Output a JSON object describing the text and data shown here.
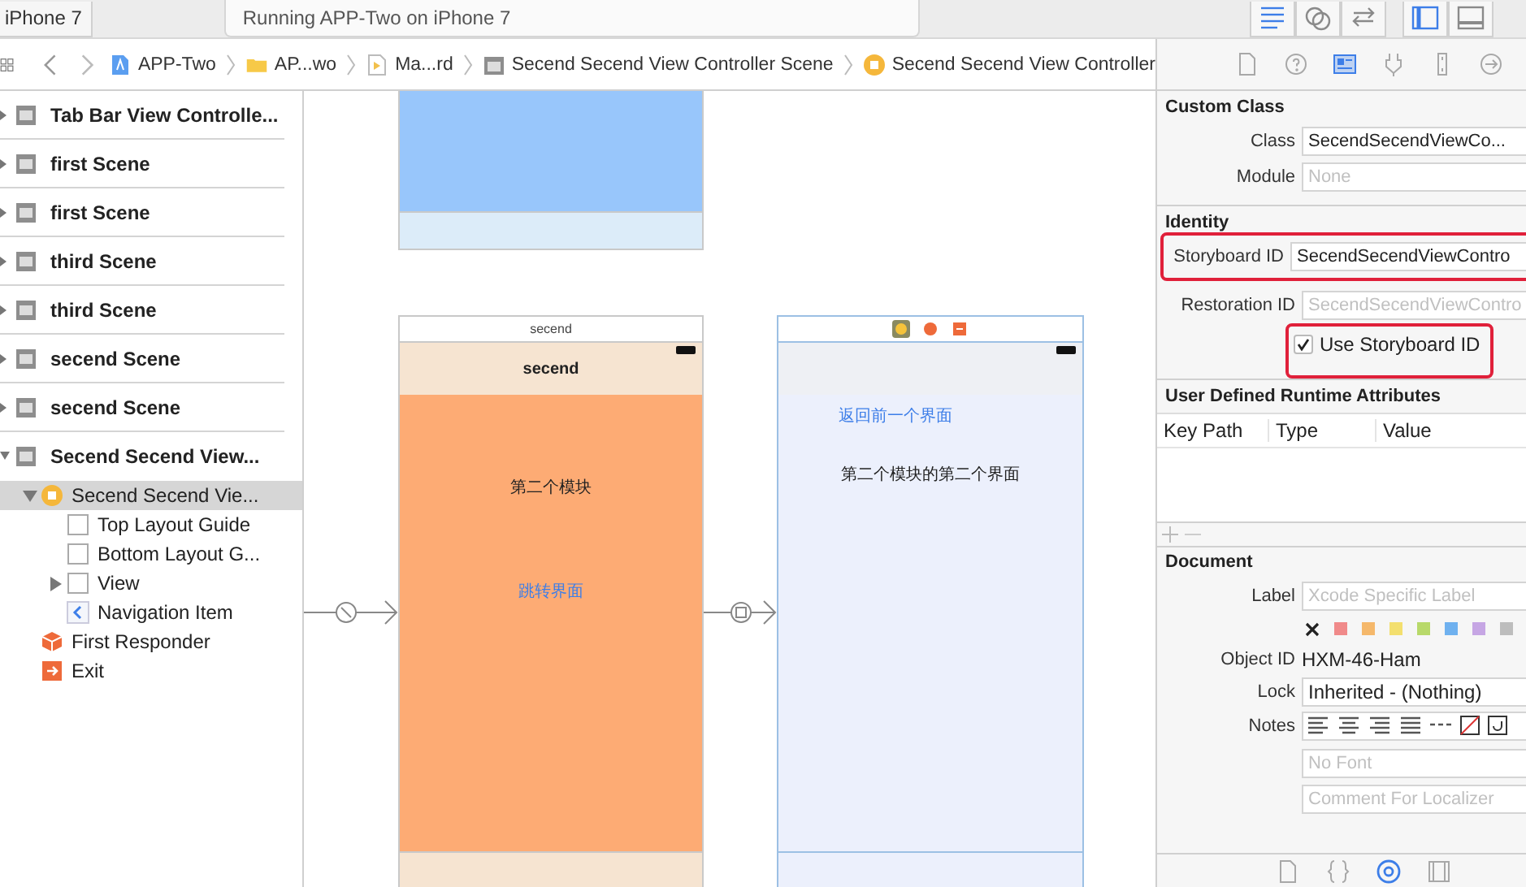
{
  "toolbar": {
    "scheme": "iPhone 7",
    "status": "Running APP-Two on iPhone 7",
    "buttons": [
      {
        "kind": "editor-standard",
        "selected": true
      },
      {
        "kind": "editor-assistant",
        "selected": false
      },
      {
        "kind": "editor-version",
        "selected": false
      },
      {
        "kind": "navigator-panel",
        "selected": true
      },
      {
        "kind": "debug-panel",
        "selected": false
      }
    ]
  },
  "jump_bar": [
    {
      "kind": "project",
      "label": "APP-Two"
    },
    {
      "kind": "folder",
      "label": "AP...wo"
    },
    {
      "kind": "storyboard",
      "label": "Ma...rd"
    },
    {
      "kind": "scene",
      "label": "Secend Secend View Controller Scene"
    },
    {
      "kind": "controller",
      "label": "Secend Secend View Controller"
    }
  ],
  "inspector_tabs": [
    {
      "kind": "file",
      "selected": false
    },
    {
      "kind": "help",
      "selected": false
    },
    {
      "kind": "identity",
      "selected": true
    },
    {
      "kind": "attributes",
      "selected": false
    },
    {
      "kind": "size",
      "selected": false
    },
    {
      "kind": "connections",
      "selected": false
    }
  ],
  "outline": [
    {
      "title": "Tab Bar View Controlle...",
      "expanded": false,
      "selected": false
    },
    {
      "title": "first Scene",
      "expanded": false,
      "selected": false
    },
    {
      "title": "first Scene",
      "expanded": false,
      "selected": false
    },
    {
      "title": "third Scene",
      "expanded": false,
      "selected": false
    },
    {
      "title": "third Scene",
      "expanded": false,
      "selected": false
    },
    {
      "title": "secend Scene",
      "expanded": false,
      "selected": false
    },
    {
      "title": "secend Scene",
      "expanded": false,
      "selected": false
    },
    {
      "title": "Secend Secend View...",
      "expanded": true,
      "selected": false,
      "children": [
        {
          "kind": "controller",
          "label": "Secend Secend Vie...",
          "expanded": true,
          "selected": true,
          "children": [
            {
              "kind": "guide",
              "label": "Top Layout Guide",
              "selected": false
            },
            {
              "kind": "guide",
              "label": "Bottom Layout G...",
              "selected": false
            },
            {
              "kind": "view",
              "label": "View",
              "expanded": false,
              "selected": false
            },
            {
              "kind": "navigation",
              "label": "Navigation Item",
              "selected": false
            }
          ]
        },
        {
          "kind": "responder",
          "label": "First Responder",
          "selected": false
        },
        {
          "kind": "exit",
          "label": "Exit",
          "selected": false
        }
      ]
    }
  ],
  "canvas": {
    "scenes": [
      {
        "kind": "partial",
        "color": "#98c6fb"
      },
      {
        "kind": "navigation-child",
        "title": "secend",
        "nav_title": "secend",
        "color": "#fdab74",
        "labels": [
          {
            "kind": "label",
            "text": "第二个模块"
          },
          {
            "kind": "button",
            "text": "跳转界面"
          }
        ]
      },
      {
        "kind": "controller",
        "color": "#ecf0fc",
        "labels": [
          {
            "kind": "button",
            "text": "返回前一个界面"
          },
          {
            "kind": "label",
            "text": "第二个模块的第二个界面"
          }
        ]
      }
    ]
  },
  "inspector": {
    "custom_class": {
      "heading": "Custom Class",
      "class": {
        "label": "Class",
        "value": "SecendSecendViewCo..."
      },
      "module": {
        "label": "Module",
        "placeholder": "None"
      }
    },
    "identity": {
      "heading": "Identity",
      "storyboard_id": {
        "label": "Storyboard ID",
        "value": "SecendSecendViewContro",
        "highlighted": true
      },
      "restoration_id": {
        "label": "Restoration ID",
        "placeholder": "SecendSecendViewContro"
      },
      "use_storyboard_id": {
        "label": "Use Storyboard ID",
        "checked": true,
        "highlighted": true
      }
    },
    "runtime_attributes": {
      "heading": "User Defined Runtime Attributes",
      "columns": [
        "Key Path",
        "Type",
        "Value"
      ]
    },
    "document": {
      "heading": "Document",
      "label": {
        "label": "Label",
        "placeholder": "Xcode Specific Label"
      },
      "colors": [
        {
          "color": "#f08a8a"
        },
        {
          "color": "#f5b86b"
        },
        {
          "color": "#f3df6e"
        },
        {
          "color": "#b8d96a"
        },
        {
          "color": "#6fb1ef"
        },
        {
          "color": "#c6a6e4"
        },
        {
          "color": "#bdbdbd"
        }
      ],
      "object_id": {
        "label": "Object ID",
        "value": "HXM-46-Ham"
      },
      "lock": {
        "label": "Lock",
        "value": "Inherited - (Nothing)"
      },
      "notes": {
        "label": "Notes",
        "font_placeholder": "No Font",
        "comment_placeholder": "Comment For Localizer"
      }
    }
  },
  "library_tabs": [
    {
      "kind": "file",
      "selected": false
    },
    {
      "kind": "code",
      "selected": false
    },
    {
      "kind": "object",
      "selected": true
    },
    {
      "kind": "media",
      "selected": false
    }
  ]
}
